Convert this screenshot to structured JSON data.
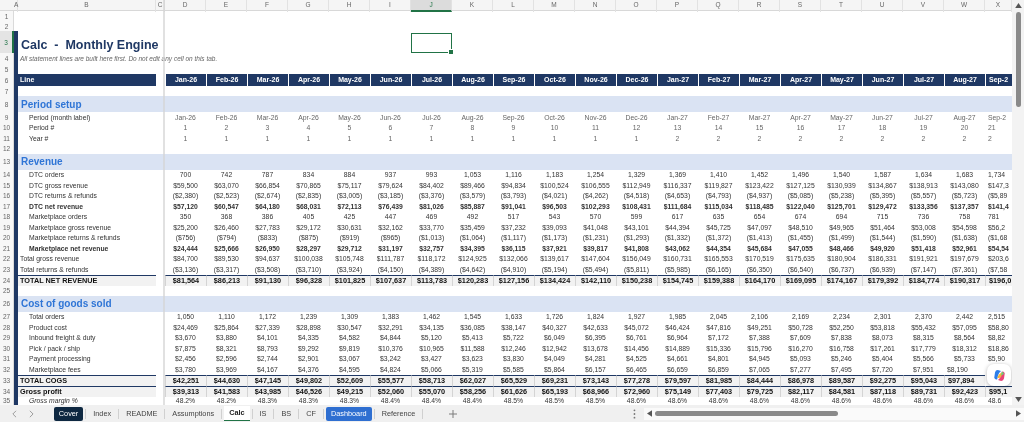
{
  "columns": [
    {
      "letter": "A",
      "selected": false
    },
    {
      "letter": "B",
      "selected": false
    },
    {
      "letter": "C",
      "selected": false
    },
    {
      "letter": "D",
      "selected": false
    },
    {
      "letter": "E",
      "selected": false
    },
    {
      "letter": "F",
      "selected": false
    },
    {
      "letter": "G",
      "selected": false
    },
    {
      "letter": "H",
      "selected": false
    },
    {
      "letter": "I",
      "selected": false
    },
    {
      "letter": "J",
      "selected": true
    },
    {
      "letter": "K",
      "selected": false
    },
    {
      "letter": "L",
      "selected": false
    },
    {
      "letter": "M",
      "selected": false
    },
    {
      "letter": "N",
      "selected": false
    },
    {
      "letter": "O",
      "selected": false
    },
    {
      "letter": "P",
      "selected": false
    },
    {
      "letter": "Q",
      "selected": false
    },
    {
      "letter": "R",
      "selected": false
    },
    {
      "letter": "S",
      "selected": false
    },
    {
      "letter": "T",
      "selected": false
    },
    {
      "letter": "U",
      "selected": false
    },
    {
      "letter": "V",
      "selected": false
    },
    {
      "letter": "W",
      "selected": false
    },
    {
      "letter": "X",
      "selected": false
    }
  ],
  "rows": [
    {
      "number": "1",
      "selected": false,
      "kind": "blank"
    },
    {
      "number": "2",
      "selected": false,
      "kind": "blank"
    },
    {
      "number": "3",
      "selected": true,
      "kind": "title",
      "text": "Calc  -  Monthly Engine"
    },
    {
      "number": "4",
      "selected": false,
      "kind": "subtitle",
      "text": "All statement lines are built here first. Do not edit any cell on this tab."
    },
    {
      "number": "5",
      "selected": false,
      "kind": "blank"
    },
    {
      "number": "6",
      "selected": false,
      "kind": "header",
      "label": "Line",
      "values": [
        "Jan-26",
        "Feb-26",
        "Mar-26",
        "Apr-26",
        "May-26",
        "Jun-26",
        "Jul-26",
        "Aug-26",
        "Sep-26",
        "Oct-26",
        "Nov-26",
        "Dec-26",
        "Jan-27",
        "Feb-27",
        "Mar-27",
        "Apr-27",
        "May-27",
        "Jun-27",
        "Jul-27",
        "Aug-27",
        "Sep-2"
      ]
    },
    {
      "number": "7",
      "selected": false,
      "kind": "blank"
    },
    {
      "number": "8",
      "selected": false,
      "kind": "section",
      "label": "Period setup"
    },
    {
      "number": "9",
      "selected": false,
      "kind": "meta",
      "label": "Period (month label)",
      "values": [
        "Jan-26",
        "Feb-26",
        "Mar-26",
        "Apr-26",
        "May-26",
        "Jun-26",
        "Jul-26",
        "Aug-26",
        "Sep-26",
        "Oct-26",
        "Nov-26",
        "Dec-26",
        "Jan-27",
        "Feb-27",
        "Mar-27",
        "Apr-27",
        "May-27",
        "Jun-27",
        "Jul-27",
        "Aug-27",
        "Sep-2"
      ]
    },
    {
      "number": "10",
      "selected": false,
      "kind": "meta",
      "label": "Period #",
      "values": [
        "1",
        "2",
        "3",
        "4",
        "5",
        "6",
        "7",
        "8",
        "9",
        "10",
        "11",
        "12",
        "13",
        "14",
        "15",
        "16",
        "17",
        "18",
        "19",
        "20",
        "21"
      ]
    },
    {
      "number": "11",
      "selected": false,
      "kind": "meta",
      "label": "Year #",
      "values": [
        "1",
        "1",
        "1",
        "1",
        "1",
        "1",
        "1",
        "1",
        "1",
        "1",
        "1",
        "1",
        "2",
        "2",
        "2",
        "2",
        "2",
        "2",
        "2",
        "2",
        "2"
      ]
    },
    {
      "number": "12",
      "selected": false,
      "kind": "blank"
    },
    {
      "number": "13",
      "selected": false,
      "kind": "section",
      "label": "Revenue"
    },
    {
      "number": "14",
      "selected": false,
      "kind": "item",
      "label": "DTC orders",
      "values": [
        "700",
        "742",
        "787",
        "834",
        "884",
        "937",
        "993",
        "1,053",
        "1,116",
        "1,183",
        "1,254",
        "1,329",
        "1,369",
        "1,410",
        "1,452",
        "1,496",
        "1,540",
        "1,587",
        "1,634",
        "1,683",
        "1,734"
      ]
    },
    {
      "number": "15",
      "selected": false,
      "kind": "item",
      "label": "DTC gross revenue",
      "values": [
        "$59,500",
        "$63,070",
        "$66,854",
        "$70,865",
        "$75,117",
        "$79,624",
        "$84,402",
        "$89,466",
        "$94,834",
        "$100,524",
        "$106,555",
        "$112,949",
        "$116,337",
        "$119,827",
        "$123,422",
        "$127,125",
        "$130,939",
        "$134,867",
        "$138,913",
        "$143,080",
        "$147,3"
      ]
    },
    {
      "number": "16",
      "selected": false,
      "kind": "item",
      "label": "DTC returns & refunds",
      "values": [
        "($2,380)",
        "($2,523)",
        "($2,674)",
        "($2,835)",
        "($3,005)",
        "($3,185)",
        "($3,376)",
        "($3,579)",
        "($3,793)",
        "($4,021)",
        "($4,262)",
        "($4,518)",
        "($4,653)",
        "($4,793)",
        "($4,937)",
        "($5,085)",
        "($5,238)",
        "($5,395)",
        "($5,557)",
        "($5,723)",
        "($5,89"
      ]
    },
    {
      "number": "17",
      "selected": false,
      "kind": "subtotal",
      "label": "DTC net revenue",
      "values": [
        "$57,120",
        "$60,547",
        "$64,180",
        "$68,031",
        "$72,113",
        "$76,439",
        "$81,026",
        "$85,887",
        "$91,041",
        "$96,503",
        "$102,293",
        "$108,431",
        "$111,684",
        "$115,034",
        "$118,485",
        "$122,040",
        "$125,701",
        "$129,472",
        "$133,356",
        "$137,357",
        "$141,4"
      ]
    },
    {
      "number": "18",
      "selected": false,
      "kind": "item",
      "label": "Marketplace orders",
      "values": [
        "350",
        "368",
        "386",
        "405",
        "425",
        "447",
        "469",
        "492",
        "517",
        "543",
        "570",
        "599",
        "617",
        "635",
        "654",
        "674",
        "694",
        "715",
        "736",
        "758",
        "781"
      ]
    },
    {
      "number": "19",
      "selected": false,
      "kind": "item",
      "label": "Marketplace gross revenue",
      "values": [
        "$25,200",
        "$26,460",
        "$27,783",
        "$29,172",
        "$30,631",
        "$32,162",
        "$33,770",
        "$35,459",
        "$37,232",
        "$39,093",
        "$41,048",
        "$43,101",
        "$44,394",
        "$45,725",
        "$47,097",
        "$48,510",
        "$49,965",
        "$51,464",
        "$53,008",
        "$54,598",
        "$56,2"
      ]
    },
    {
      "number": "20",
      "selected": false,
      "kind": "item",
      "label": "Marketplace returns & refunds",
      "values": [
        "($756)",
        "($794)",
        "($833)",
        "($875)",
        "($919)",
        "($965)",
        "($1,013)",
        "($1,064)",
        "($1,117)",
        "($1,173)",
        "($1,231)",
        "($1,293)",
        "($1,332)",
        "($1,372)",
        "($1,413)",
        "($1,455)",
        "($1,499)",
        "($1,544)",
        "($1,590)",
        "($1,638)",
        "($1,68"
      ]
    },
    {
      "number": "21",
      "selected": false,
      "kind": "subtotal",
      "label": "Marketplace net revenue",
      "values": [
        "$24,444",
        "$25,666",
        "$26,950",
        "$28,297",
        "$29,712",
        "$31,197",
        "$32,757",
        "$34,395",
        "$36,115",
        "$37,921",
        "$39,817",
        "$41,808",
        "$43,062",
        "$44,354",
        "$45,684",
        "$47,055",
        "$48,466",
        "$49,920",
        "$51,418",
        "$52,961",
        "$54,54"
      ]
    },
    {
      "number": "22",
      "selected": false,
      "kind": "plain",
      "label": "Total gross revenue",
      "values": [
        "$84,700",
        "$89,530",
        "$94,637",
        "$100,038",
        "$105,748",
        "$111,787",
        "$118,172",
        "$124,925",
        "$132,066",
        "$139,617",
        "$147,604",
        "$156,049",
        "$160,731",
        "$165,553",
        "$170,519",
        "$175,635",
        "$180,904",
        "$186,331",
        "$191,921",
        "$197,679",
        "$203,6"
      ]
    },
    {
      "number": "23",
      "selected": false,
      "kind": "plain",
      "label": "Total returns & refunds",
      "values": [
        "($3,136)",
        "($3,317)",
        "($3,508)",
        "($3,710)",
        "($3,924)",
        "($4,150)",
        "($4,389)",
        "($4,642)",
        "($4,910)",
        "($5,194)",
        "($5,494)",
        "($5,811)",
        "($5,985)",
        "($6,165)",
        "($6,350)",
        "($6,540)",
        "($6,737)",
        "($6,939)",
        "($7,147)",
        "($7,361)",
        "($7,58"
      ]
    },
    {
      "number": "24",
      "selected": false,
      "kind": "total",
      "label": "TOTAL NET REVENUE",
      "values": [
        "$81,564",
        "$86,213",
        "$91,130",
        "$96,328",
        "$101,825",
        "$107,637",
        "$113,783",
        "$120,283",
        "$127,156",
        "$134,424",
        "$142,110",
        "$150,238",
        "$154,745",
        "$159,388",
        "$164,170",
        "$169,095",
        "$174,167",
        "$179,392",
        "$184,774",
        "$190,317",
        "$196,0"
      ]
    },
    {
      "number": "25",
      "selected": false,
      "kind": "blank"
    },
    {
      "number": "26",
      "selected": false,
      "kind": "section",
      "label": "Cost of goods sold"
    },
    {
      "number": "27",
      "selected": false,
      "kind": "item",
      "label": "Total orders",
      "values": [
        "1,050",
        "1,110",
        "1,172",
        "1,239",
        "1,309",
        "1,383",
        "1,462",
        "1,545",
        "1,633",
        "1,726",
        "1,824",
        "1,927",
        "1,985",
        "2,045",
        "2,106",
        "2,169",
        "2,234",
        "2,301",
        "2,370",
        "2,442",
        "2,515"
      ]
    },
    {
      "number": "28",
      "selected": false,
      "kind": "item",
      "label": "Product cost",
      "values": [
        "$24,469",
        "$25,864",
        "$27,339",
        "$28,898",
        "$30,547",
        "$32,291",
        "$34,135",
        "$36,085",
        "$38,147",
        "$40,327",
        "$42,633",
        "$45,072",
        "$46,424",
        "$47,816",
        "$49,251",
        "$50,728",
        "$52,250",
        "$53,818",
        "$55,432",
        "$57,095",
        "$58,80"
      ]
    },
    {
      "number": "29",
      "selected": false,
      "kind": "item",
      "label": "Inbound freight & duty",
      "values": [
        "$3,670",
        "$3,880",
        "$4,101",
        "$4,335",
        "$4,582",
        "$4,844",
        "$5,120",
        "$5,413",
        "$5,722",
        "$6,049",
        "$6,395",
        "$6,761",
        "$6,964",
        "$7,172",
        "$7,388",
        "$7,609",
        "$7,838",
        "$8,073",
        "$8,315",
        "$8,564",
        "$8,82"
      ]
    },
    {
      "number": "30",
      "selected": false,
      "kind": "item",
      "label": "Pick / pack / ship",
      "values": [
        "$7,875",
        "$8,321",
        "$8,793",
        "$9,292",
        "$9,819",
        "$10,376",
        "$10,965",
        "$11,588",
        "$12,246",
        "$12,942",
        "$13,678",
        "$14,456",
        "$14,889",
        "$15,336",
        "$15,796",
        "$16,270",
        "$16,758",
        "$17,261",
        "$17,779",
        "$18,312",
        "$18,86"
      ]
    },
    {
      "number": "31",
      "selected": false,
      "kind": "item",
      "label": "Payment processing",
      "values": [
        "$2,456",
        "$2,596",
        "$2,744",
        "$2,901",
        "$3,067",
        "$3,242",
        "$3,427",
        "$3,623",
        "$3,830",
        "$4,049",
        "$4,281",
        "$4,525",
        "$4,661",
        "$4,801",
        "$4,945",
        "$5,093",
        "$5,246",
        "$5,404",
        "$5,566",
        "$5,733",
        "$5,90"
      ]
    },
    {
      "number": "32",
      "selected": false,
      "kind": "item",
      "label": "Marketplace fees",
      "values": [
        "$3,780",
        "$3,969",
        "$4,167",
        "$4,376",
        "$4,595",
        "$4,824",
        "$5,066",
        "$5,319",
        "$5,585",
        "$5,864",
        "$6,157",
        "$6,465",
        "$6,659",
        "$6,859",
        "$7,065",
        "$7,277",
        "$7,495",
        "$7,720",
        "$7,951",
        "$8,190"
      ]
    },
    {
      "number": "33",
      "selected": false,
      "kind": "total",
      "label": "TOTAL COGS",
      "values": [
        "$42,251",
        "$44,630",
        "$47,145",
        "$49,802",
        "$52,609",
        "$55,577",
        "$58,713",
        "$62,027",
        "$65,529",
        "$69,231",
        "$73,143",
        "$77,278",
        "$79,597",
        "$81,985",
        "$84,444",
        "$86,978",
        "$89,587",
        "$92,275",
        "$95,043",
        "$97,894"
      ]
    },
    {
      "number": "34",
      "selected": false,
      "kind": "total",
      "label": "Gross profit",
      "values": [
        "$39,313",
        "$41,583",
        "$43,985",
        "$46,526",
        "$49,215",
        "$52,060",
        "$55,070",
        "$58,256",
        "$61,626",
        "$65,193",
        "$68,966",
        "$72,960",
        "$75,149",
        "$77,403",
        "$79,725",
        "$82,117",
        "$84,581",
        "$87,118",
        "$89,731",
        "$92,423",
        "$95,1"
      ]
    },
    {
      "number": "35",
      "selected": false,
      "kind": "percent",
      "label": "Gross margin %",
      "values": [
        "48.2%",
        "48.2%",
        "48.3%",
        "48.3%",
        "48.3%",
        "48.4%",
        "48.4%",
        "48.4%",
        "48.5%",
        "48.5%",
        "48.5%",
        "48.6%",
        "48.6%",
        "48.6%",
        "48.6%",
        "48.6%",
        "48.6%",
        "48.6%",
        "48.6%",
        "48.6%",
        "48.6"
      ]
    }
  ],
  "sheet_tabs": [
    {
      "label": "Cover",
      "selected": false,
      "color": "#0e2841"
    },
    {
      "label": "Index",
      "selected": false
    },
    {
      "label": "README",
      "selected": false
    },
    {
      "label": "Assumptions",
      "selected": false
    },
    {
      "label": "Calc",
      "selected": true
    },
    {
      "label": "IS",
      "selected": false
    },
    {
      "label": "BS",
      "selected": false
    },
    {
      "label": "CF",
      "selected": false
    },
    {
      "label": "Dashboard",
      "selected": false,
      "color": "#2f6fd1"
    },
    {
      "label": "Reference",
      "selected": false
    }
  ]
}
